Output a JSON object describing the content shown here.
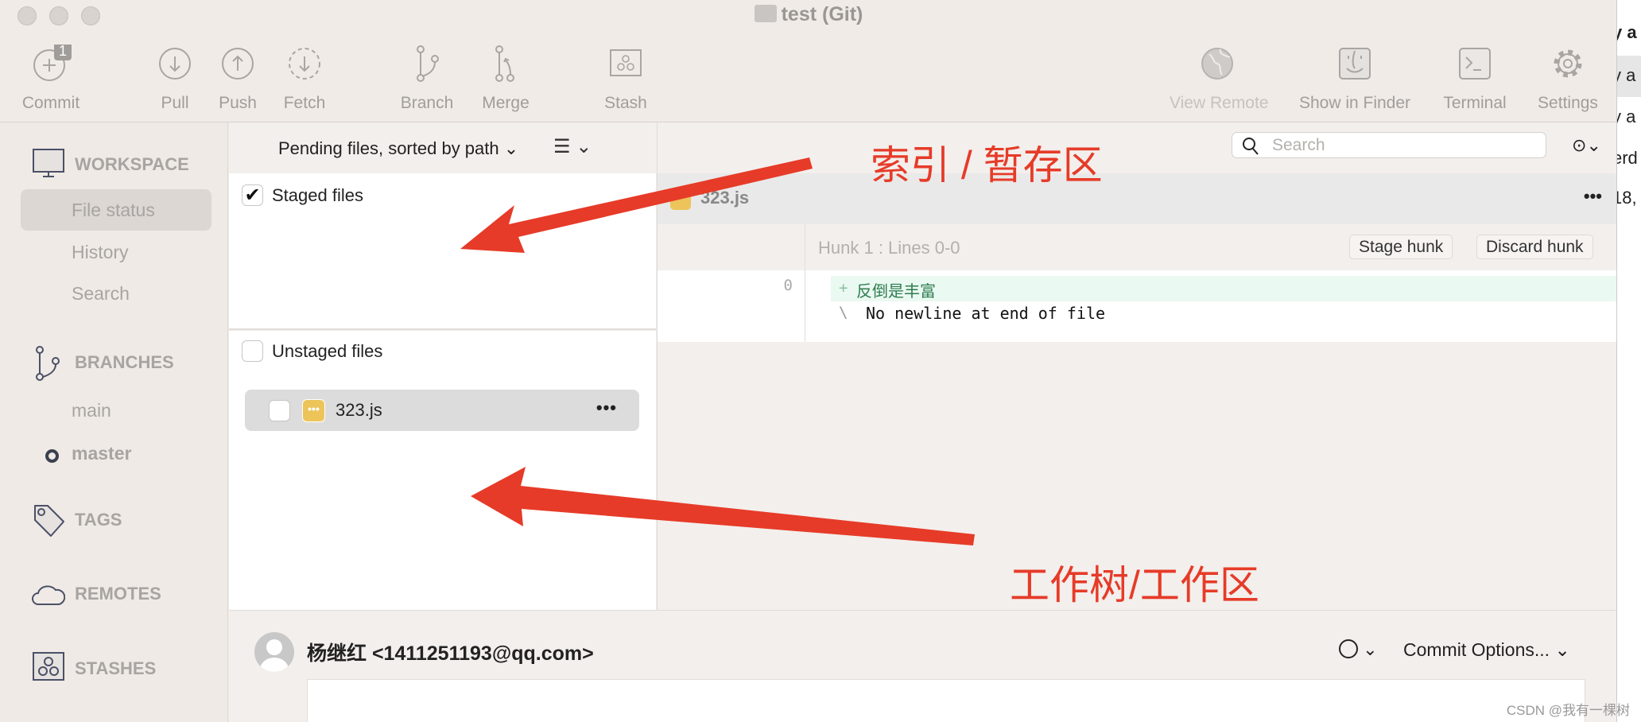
{
  "window": {
    "title": "test (Git)"
  },
  "toolbar": {
    "commit": {
      "label": "Commit",
      "badge": "1"
    },
    "pull": "Pull",
    "push": "Push",
    "fetch": "Fetch",
    "branch": "Branch",
    "merge": "Merge",
    "stash": "Stash",
    "view_remote": "View Remote",
    "show_in_finder": "Show in Finder",
    "terminal": "Terminal",
    "settings": "Settings"
  },
  "sidebar": {
    "workspace": {
      "header": "WORKSPACE",
      "items": [
        "File status",
        "History",
        "Search"
      ],
      "selected": "File status"
    },
    "branches": {
      "header": "BRANCHES",
      "items": [
        "main",
        "master"
      ],
      "current": "master"
    },
    "tags": "TAGS",
    "remotes": "REMOTES",
    "stashes": "STASHES"
  },
  "filelist": {
    "sort_label": "Pending files, sorted by path",
    "staged": {
      "label": "Staged files",
      "checked": true
    },
    "unstaged": {
      "label": "Unstaged files",
      "checked": false,
      "files": [
        {
          "name": "323.js",
          "status": "modified"
        }
      ]
    }
  },
  "search": {
    "placeholder": "Search"
  },
  "diff": {
    "file": "323.js",
    "hunk": {
      "title": "Hunk 1 : Lines 0-0",
      "stage": "Stage hunk",
      "discard": "Discard hunk"
    },
    "lines": [
      {
        "num": "0",
        "marker": "+",
        "text": "反倒是丰富",
        "type": "added"
      },
      {
        "num": "",
        "marker": "\\",
        "text": "No newline at end of file",
        "type": "note"
      }
    ]
  },
  "commit": {
    "author": "杨继红 <1411251193@qq.com>",
    "options": "Commit Options..."
  },
  "annotations": {
    "index": "索引 / 暂存区",
    "worktree": "工作树/工作区"
  },
  "background_window": {
    "fragments": [
      "y a",
      "y a",
      "y a",
      "erd",
      "18,"
    ]
  },
  "watermark": "CSDN @我有一棵树",
  "colors": {
    "annotation": "#e63b28",
    "added_bg": "#eaf9f1",
    "added_text": "#2e7d4f",
    "modified_badge": "#ecc45a"
  }
}
